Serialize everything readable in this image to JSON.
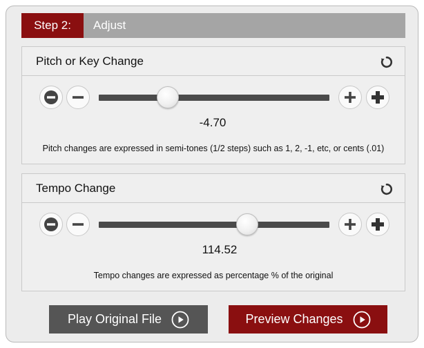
{
  "step": {
    "number_label": "Step 2:",
    "title": "Adjust"
  },
  "pitch": {
    "title": "Pitch or Key Change",
    "value": "-4.70",
    "slider_position": 0.3,
    "note": "Pitch changes are expressed in semi-tones (1/2 steps) such as 1, 2, -1, etc, or cents (.01)"
  },
  "tempo": {
    "title": "Tempo Change",
    "value": "114.52",
    "slider_position": 0.645,
    "note": "Tempo changes are expressed as percentage % of the original"
  },
  "buttons": {
    "play_original": "Play Original File",
    "preview_changes": "Preview Changes"
  },
  "colors": {
    "accent_red": "#8a0f10",
    "header_gray": "#a5a5a5",
    "dark_button": "#555555",
    "track": "#4a4a4a"
  },
  "icons": {
    "reset": "reset-icon",
    "decrease_large": "minus-circle-icon",
    "decrease_small": "minus-icon",
    "increase_small": "plus-icon",
    "increase_large": "plus-bold-icon",
    "play": "play-circle-icon"
  }
}
